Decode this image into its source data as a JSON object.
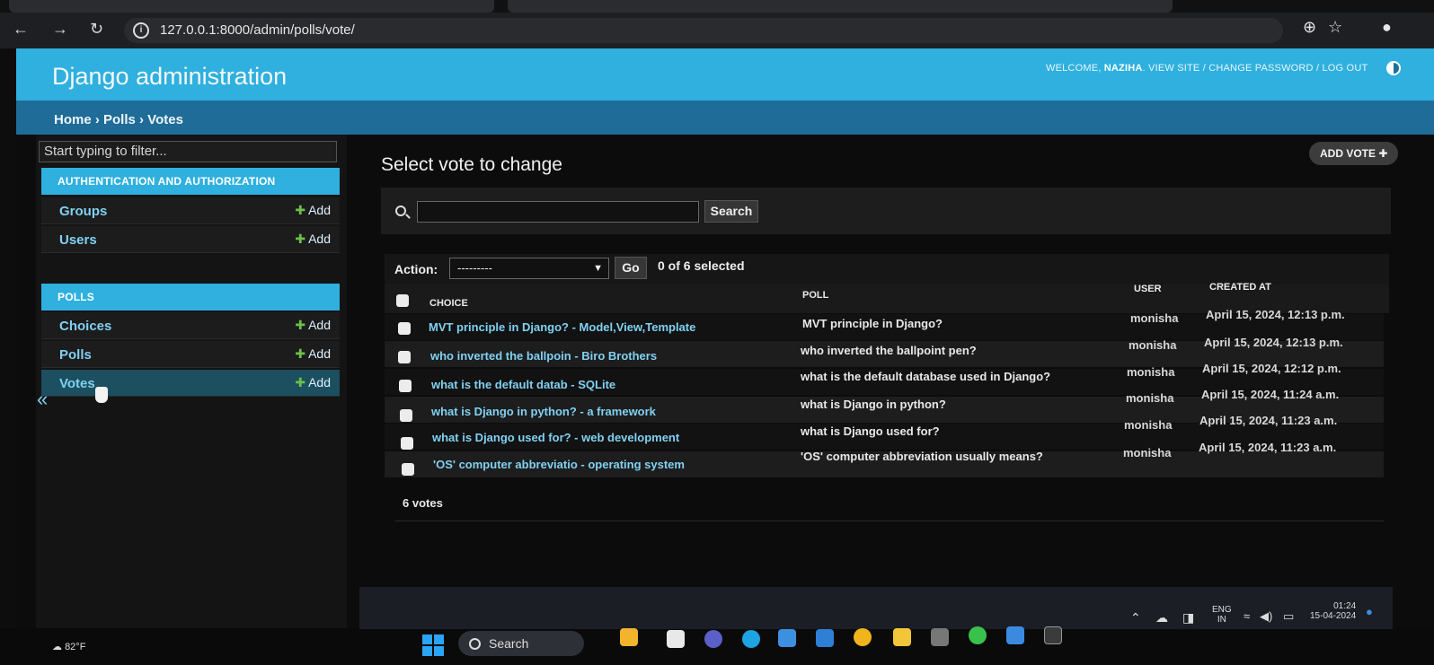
{
  "browser": {
    "url": "127.0.0.1:8000/admin/polls/vote/"
  },
  "header": {
    "brand": "Django administration",
    "welcome": "WELCOME,",
    "username": "NAZIHA",
    "links": ". VIEW SITE / CHANGE PASSWORD / LOG OUT"
  },
  "breadcrumbs": "Home › Polls › Votes",
  "sidebar": {
    "filter_placeholder": "Start typing to filter...",
    "modules": [
      {
        "caption": "AUTHENTICATION AND AUTHORIZATION",
        "items": [
          {
            "label": "Groups",
            "add": "Add"
          },
          {
            "label": "Users",
            "add": "Add"
          }
        ]
      },
      {
        "caption": "POLLS",
        "items": [
          {
            "label": "Choices",
            "add": "Add"
          },
          {
            "label": "Polls",
            "add": "Add"
          },
          {
            "label": "Votes",
            "add": "Add"
          }
        ]
      }
    ],
    "collapse_glyph": "«"
  },
  "main": {
    "title": "Select vote to change",
    "add_button": "ADD VOTE",
    "search_button": "Search",
    "action_label": "Action:",
    "action_selected": "---------",
    "go_button": "Go",
    "selected_count": "0 of 6 selected",
    "columns": [
      "CHOICE",
      "POLL",
      "USER",
      "CREATED AT"
    ],
    "rows": [
      {
        "choice": "MVT principle in Django? - Model,View,Template",
        "poll": "MVT principle in Django?",
        "user": "monisha",
        "created": "April 15, 2024, 12:13 p.m."
      },
      {
        "choice": "who inverted the ballpoin - Biro Brothers",
        "poll": "who inverted the ballpoint pen?",
        "user": "monisha",
        "created": "April 15, 2024, 12:13 p.m."
      },
      {
        "choice": "what is the default datab - SQLite",
        "poll": "what is the default database used in Django?",
        "user": "monisha",
        "created": "April 15, 2024, 12:12 p.m."
      },
      {
        "choice": "what is Django in python? - a framework",
        "poll": "what is Django in python?",
        "user": "monisha",
        "created": "April 15, 2024, 11:24 a.m."
      },
      {
        "choice": "what is Django used for? - web development",
        "poll": "what is Django used for?",
        "user": "monisha",
        "created": "April 15, 2024, 11:23 a.m."
      },
      {
        "choice": "'OS' computer abbreviatio - operating system",
        "poll": "'OS' computer abbreviation usually means?",
        "user": "monisha",
        "created": "April 15, 2024, 11:23 a.m."
      }
    ],
    "result_count": "6 votes"
  },
  "taskbar": {
    "weather": "82°F",
    "search_label": "Search",
    "lang": "ENG",
    "region": "IN",
    "time": "01:24",
    "date": "15-04-2024"
  },
  "colors": {
    "header_blue": "#2fb0df",
    "breadcrumb_blue": "#1f6c98",
    "link_blue": "#80d1f2",
    "add_green": "#6cc04a"
  }
}
